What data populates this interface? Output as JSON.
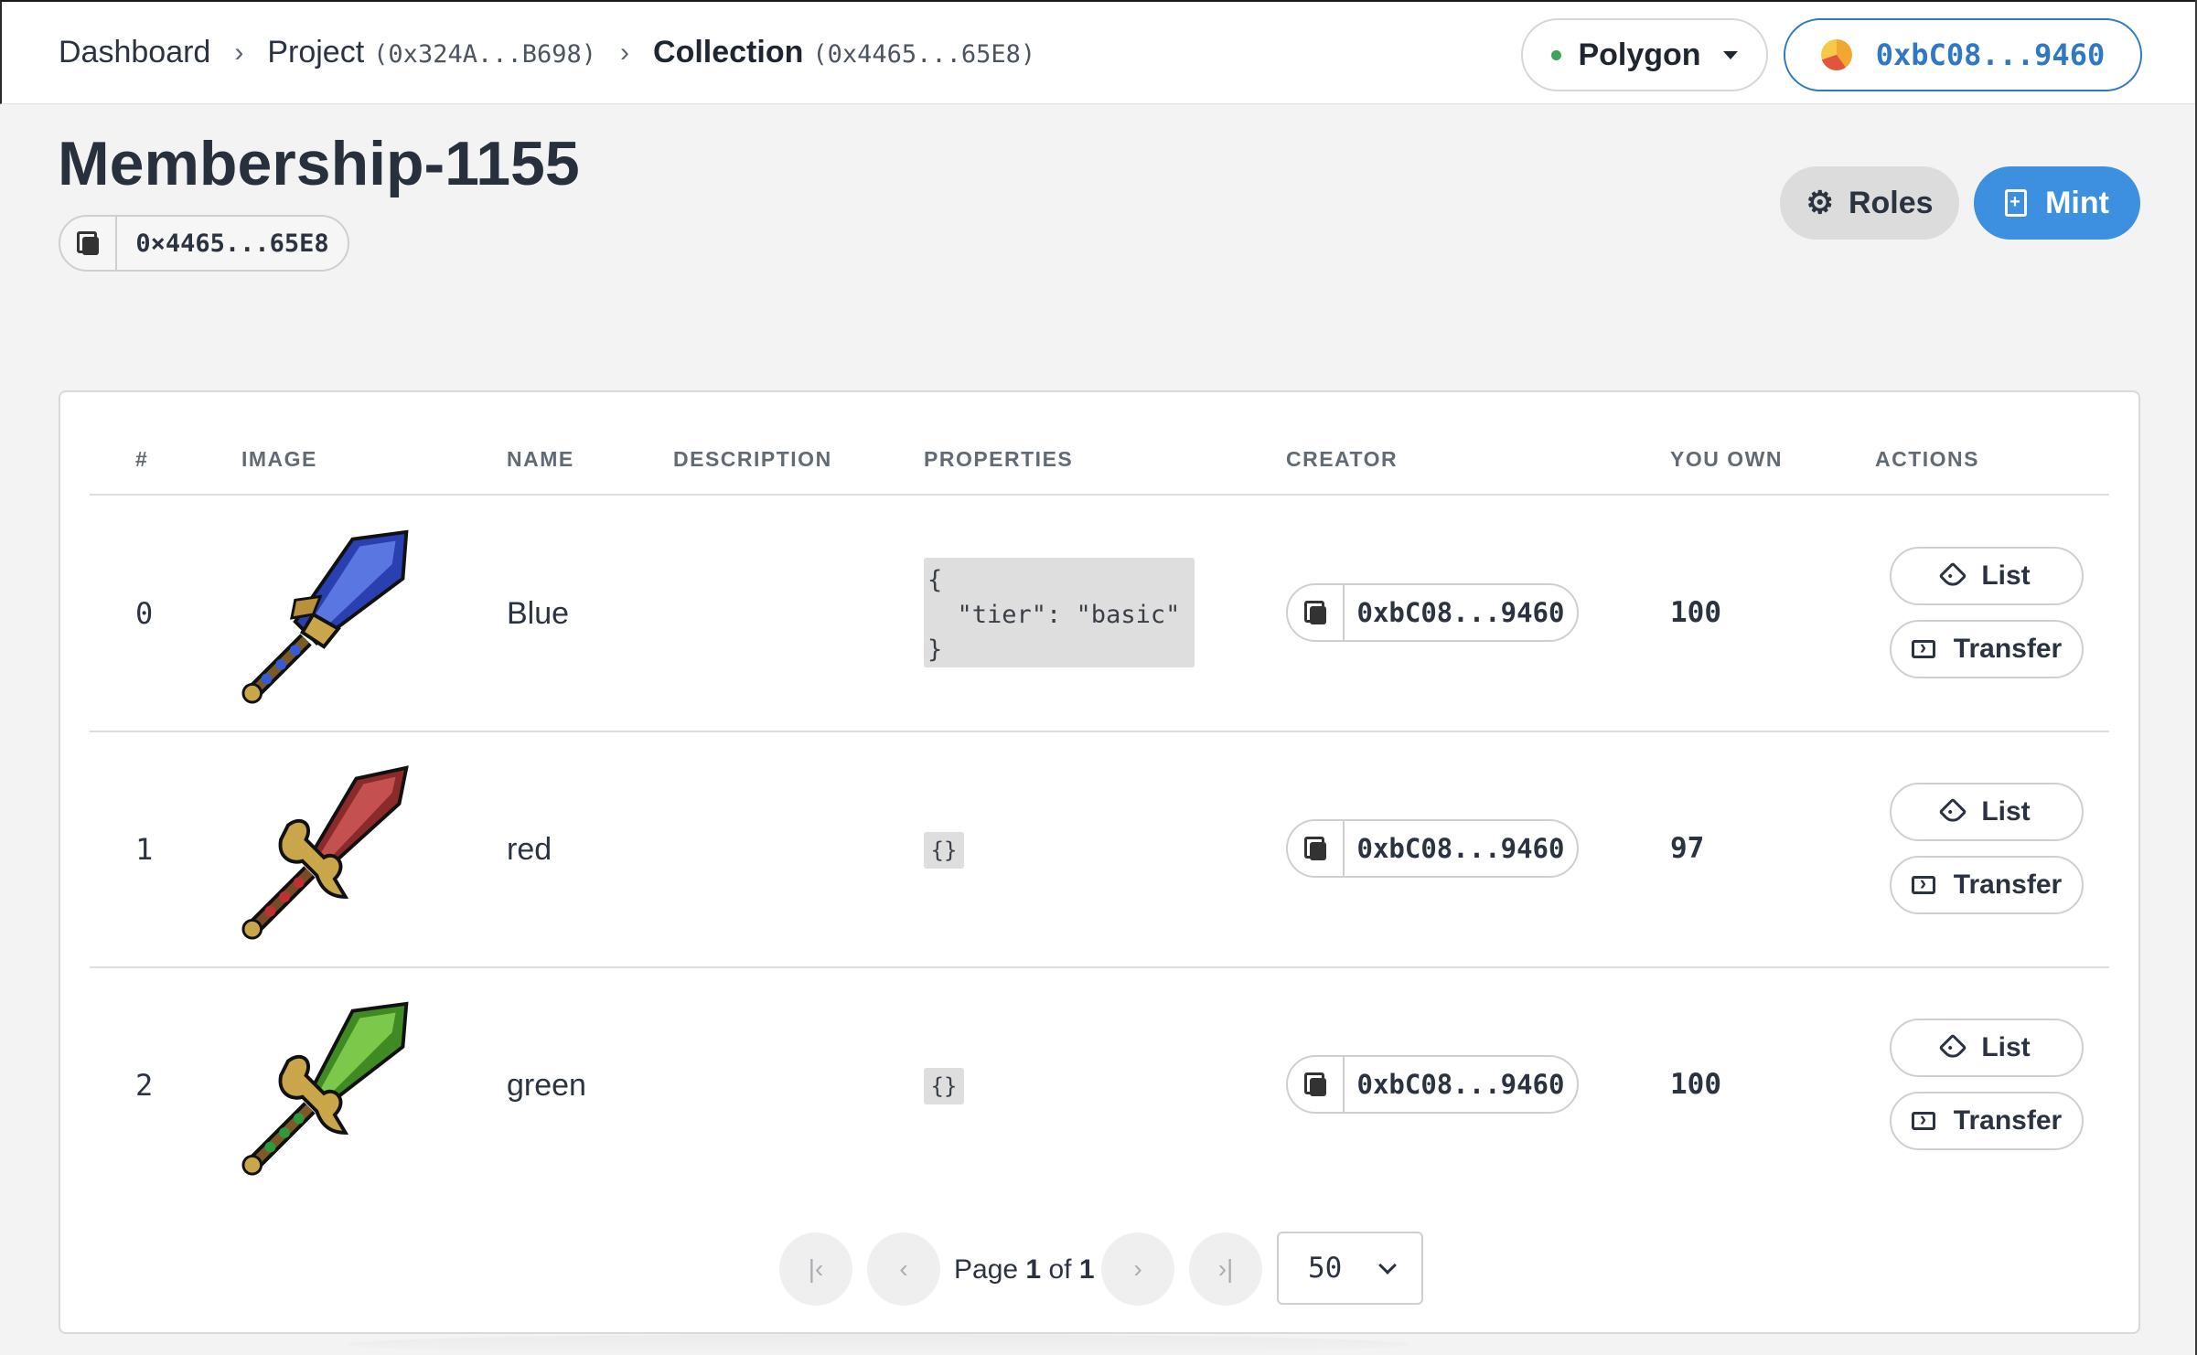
{
  "breadcrumb": {
    "dashboard": "Dashboard",
    "project_label": "Project",
    "project_addr": "(0x324A...B698)",
    "collection_label": "Collection",
    "collection_addr": "(0x4465...65E8)",
    "separator": "›"
  },
  "network": {
    "label": "Polygon",
    "status_color": "#3ba55c"
  },
  "wallet": {
    "address": "0xbC08...9460",
    "accent": "#2f78c4"
  },
  "page": {
    "title": "Membership-1155",
    "contract_address": "0×4465...65E8"
  },
  "actions": {
    "roles_label": "Roles",
    "mint_label": "Mint",
    "mint_color": "#3d8fe0"
  },
  "table": {
    "headers": [
      "#",
      "IMAGE",
      "NAME",
      "DESCRIPTION",
      "PROPERTIES",
      "CREATOR",
      "YOU OWN",
      "ACTIONS"
    ],
    "rows": [
      {
        "index": "0",
        "image": "blue-sword",
        "name": "Blue",
        "description": "",
        "properties": "{\n  \"tier\": \"basic\"\n}",
        "creator": "0xbC08...9460",
        "owned": "100",
        "list_label": "List",
        "transfer_label": "Transfer"
      },
      {
        "index": "1",
        "image": "red-sword",
        "name": "red",
        "description": "",
        "properties": "{}",
        "creator": "0xbC08...9460",
        "owned": "97",
        "list_label": "List",
        "transfer_label": "Transfer"
      },
      {
        "index": "2",
        "image": "green-sword",
        "name": "green",
        "description": "",
        "properties": "{}",
        "creator": "0xbC08...9460",
        "owned": "100",
        "list_label": "List",
        "transfer_label": "Transfer"
      }
    ]
  },
  "pagination": {
    "page_word": "Page",
    "current": "1",
    "of_word": "of",
    "total": "1",
    "page_size": "50"
  }
}
